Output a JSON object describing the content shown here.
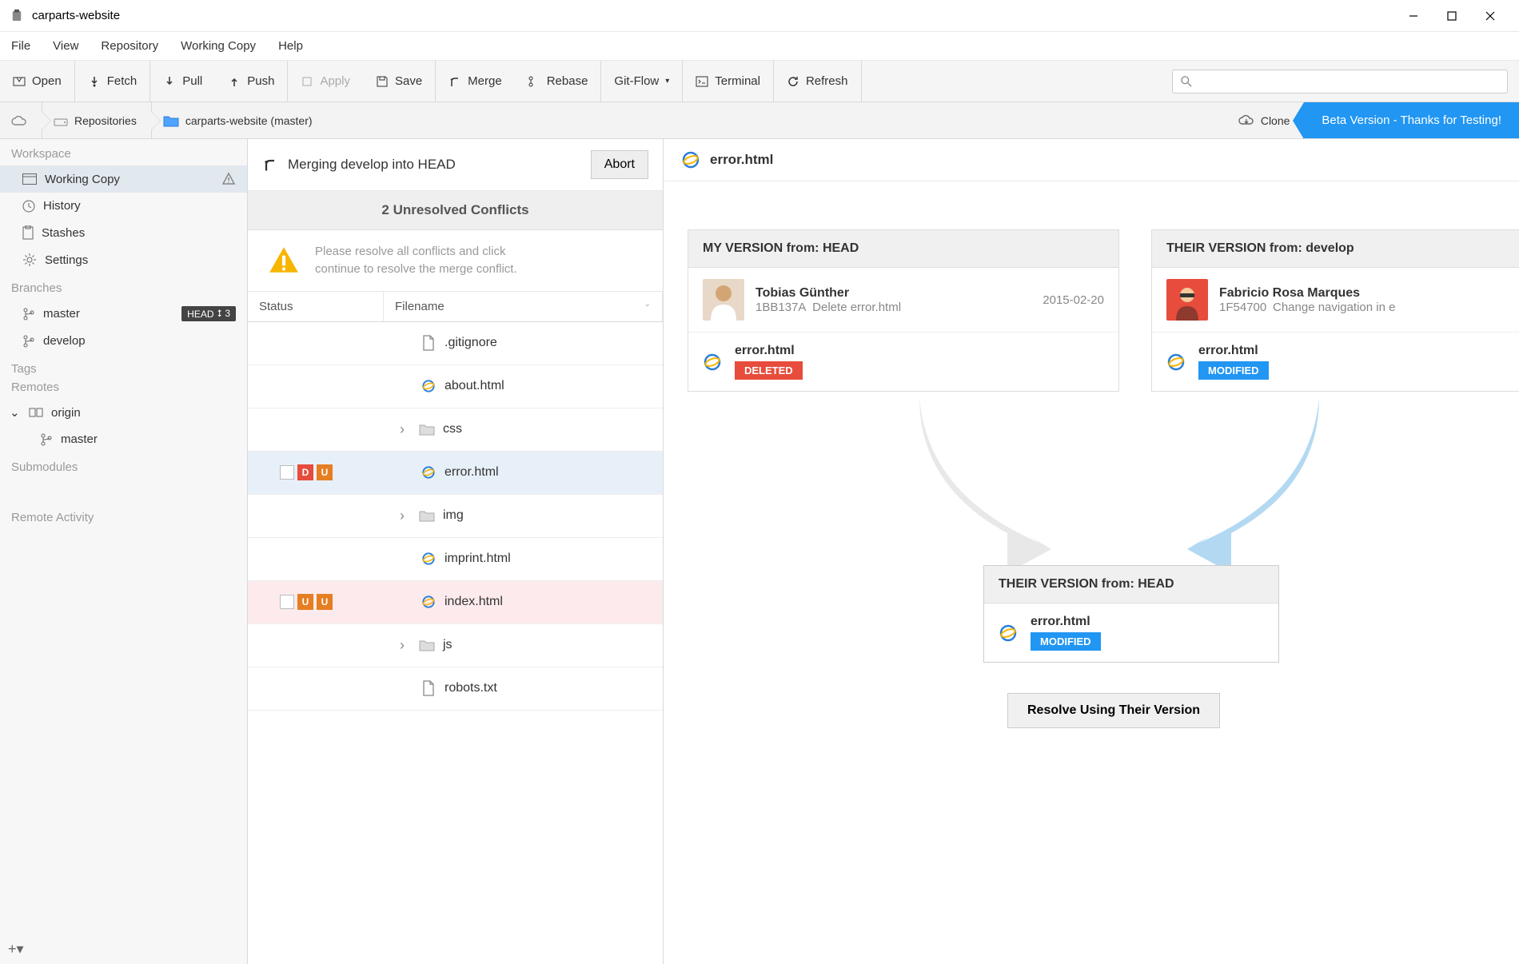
{
  "window": {
    "title": "carparts-website"
  },
  "menu": {
    "file": "File",
    "view": "View",
    "repository": "Repository",
    "working_copy": "Working Copy",
    "help": "Help"
  },
  "toolbar": {
    "open": "Open",
    "fetch": "Fetch",
    "pull": "Pull",
    "push": "Push",
    "apply": "Apply",
    "save": "Save",
    "merge": "Merge",
    "rebase": "Rebase",
    "gitflow": "Git-Flow",
    "terminal": "Terminal",
    "refresh": "Refresh",
    "search_placeholder": ""
  },
  "crumb": {
    "repos": "Repositories",
    "project": "carparts-website (master)",
    "clone": "Clone",
    "beta": "Beta Version - Thanks for Testing!"
  },
  "sidebar": {
    "workspace": "Workspace",
    "working_copy": "Working Copy",
    "history": "History",
    "stashes": "Stashes",
    "settings": "Settings",
    "branches": "Branches",
    "br_master": "master",
    "br_develop": "develop",
    "head_badge_head": "HEAD",
    "head_badge_count": "⭥ 3",
    "tags": "Tags",
    "remotes": "Remotes",
    "origin": "origin",
    "origin_master": "master",
    "submodules": "Submodules",
    "remote_activity": "Remote Activity"
  },
  "middle": {
    "merge_text": "Merging develop into HEAD",
    "abort": "Abort",
    "conflicts": "2 Unresolved Conflicts",
    "warn_l1": "Please resolve all conflicts and click",
    "warn_l2": "continue to resolve the merge conflict.",
    "th_status": "Status",
    "th_filename": "Filename",
    "files": [
      {
        "name": ".gitignore",
        "type": "file"
      },
      {
        "name": "about.html",
        "type": "ie"
      },
      {
        "name": "css",
        "type": "folder"
      },
      {
        "name": "error.html",
        "type": "ie",
        "status": [
          "D",
          "U"
        ],
        "highlight": "blue",
        "check": true
      },
      {
        "name": "img",
        "type": "folder"
      },
      {
        "name": "imprint.html",
        "type": "ie"
      },
      {
        "name": "index.html",
        "type": "ie",
        "status": [
          "U",
          "U"
        ],
        "highlight": "pink",
        "check": true
      },
      {
        "name": "js",
        "type": "folder"
      },
      {
        "name": "robots.txt",
        "type": "file"
      }
    ]
  },
  "right": {
    "file": "error.html",
    "my_title": "MY VERSION from: HEAD",
    "my_author": "Tobias Günther",
    "my_sha": "1BB137A",
    "my_msg": "Delete error.html",
    "my_date": "2015-02-20",
    "my_file": "error.html",
    "my_status": "DELETED",
    "their_title": "THEIR VERSION from: develop",
    "their_author": "Fabricio Rosa Marques",
    "their_sha": "1F54700",
    "their_msg": "Change navigation in e",
    "their_file": "error.html",
    "their_status": "MODIFIED",
    "result_title": "THEIR VERSION from: HEAD",
    "result_file": "error.html",
    "result_status": "MODIFIED",
    "resolve_btn": "Resolve Using Their Version"
  }
}
